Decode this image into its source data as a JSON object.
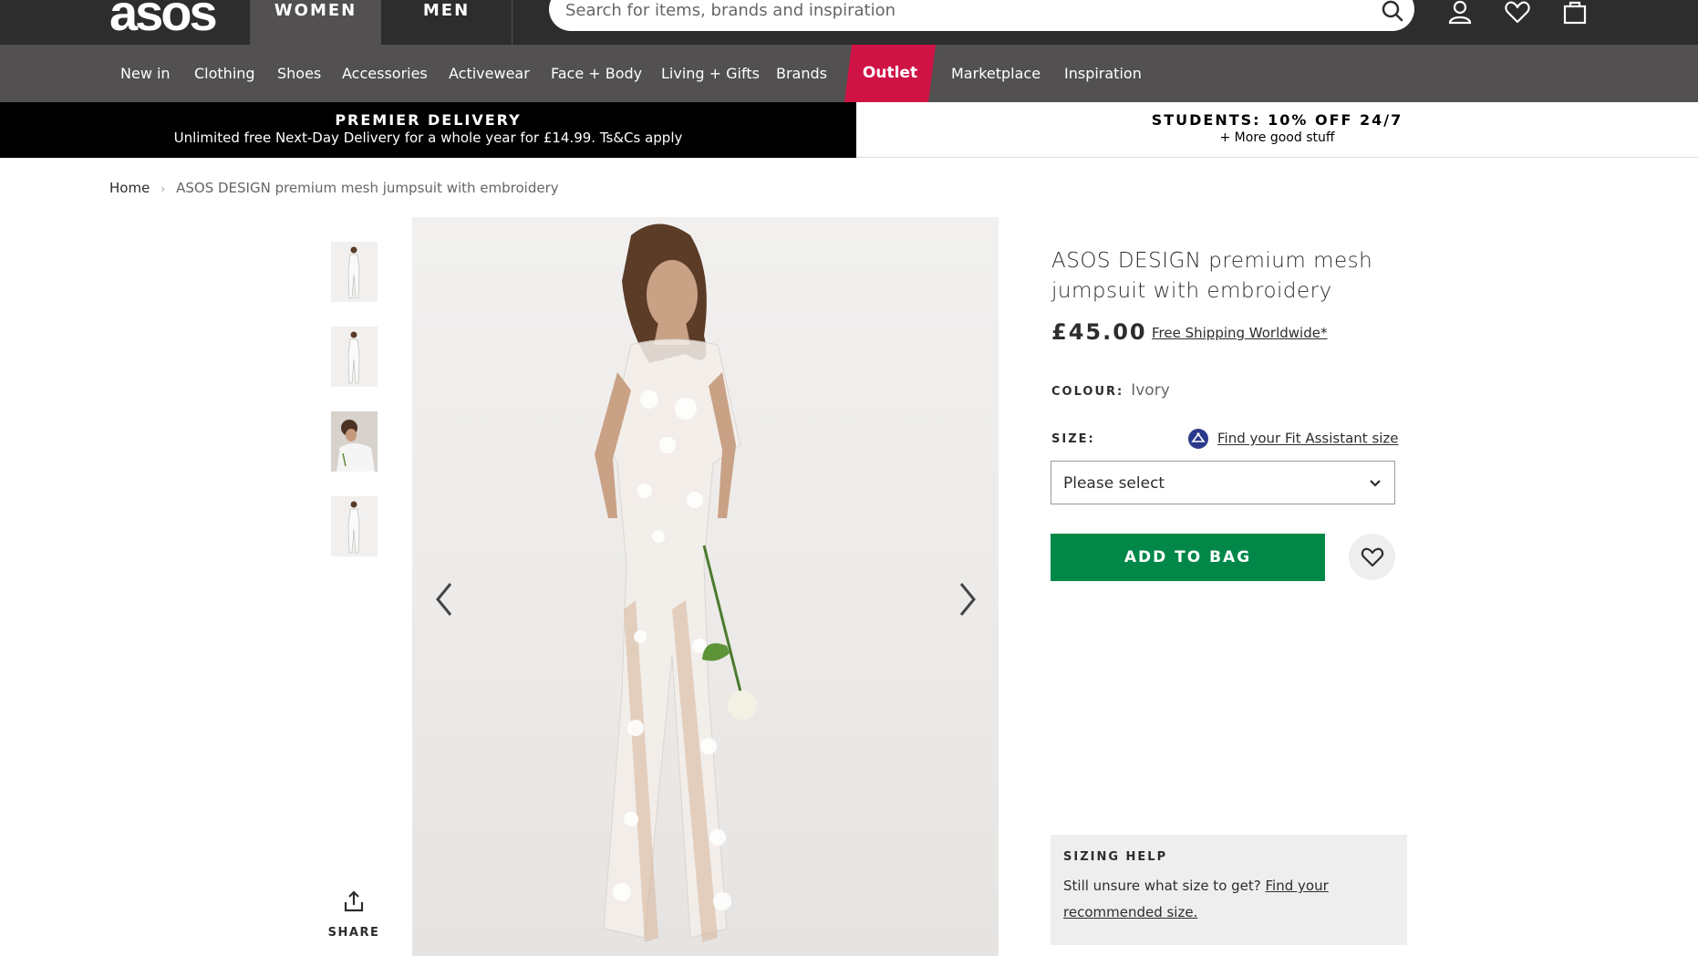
{
  "header": {
    "logo": "asos",
    "tabs": [
      {
        "label": "WOMEN",
        "active": true
      },
      {
        "label": "MEN",
        "active": false
      }
    ],
    "search": {
      "placeholder": "Search for items, brands and inspiration"
    },
    "icons": [
      "search-icon",
      "account-icon",
      "saved-items-icon",
      "bag-icon"
    ]
  },
  "nav": {
    "items": [
      "New in",
      "Clothing",
      "Shoes",
      "Accessories",
      "Activewear",
      "Face + Body",
      "Living + Gifts",
      "Brands",
      "Outlet",
      "Marketplace",
      "Inspiration"
    ],
    "highlight_color": "#d01345"
  },
  "promos": {
    "left": {
      "title": "PREMIER DELIVERY",
      "subtitle": "Unlimited free Next-Day Delivery for a whole year for £14.99. Ts&Cs apply"
    },
    "right": {
      "title": "STUDENTS: 10% OFF 24/7",
      "subtitle": "+ More good stuff"
    }
  },
  "breadcrumb": {
    "home": "Home",
    "current": "ASOS DESIGN premium mesh jumpsuit with embroidery"
  },
  "gallery": {
    "thumbnail_count": 4,
    "share_label": "SHARE"
  },
  "product": {
    "title": "ASOS DESIGN premium mesh jumpsuit with embroidery",
    "price": "£45.00",
    "shipping_link": "Free Shipping Worldwide*",
    "colour_label": "COLOUR:",
    "colour_value": "Ivory",
    "size_label": "SIZE:",
    "fit_assistant_link": "Find your Fit Assistant size",
    "size_select_value": "Please select",
    "add_to_bag": "ADD TO BAG",
    "add_to_bag_color": "#018849"
  },
  "sizing_help": {
    "title": "SIZING HELP",
    "text": "Still unsure what size to get?",
    "link": "Find your recommended size."
  }
}
